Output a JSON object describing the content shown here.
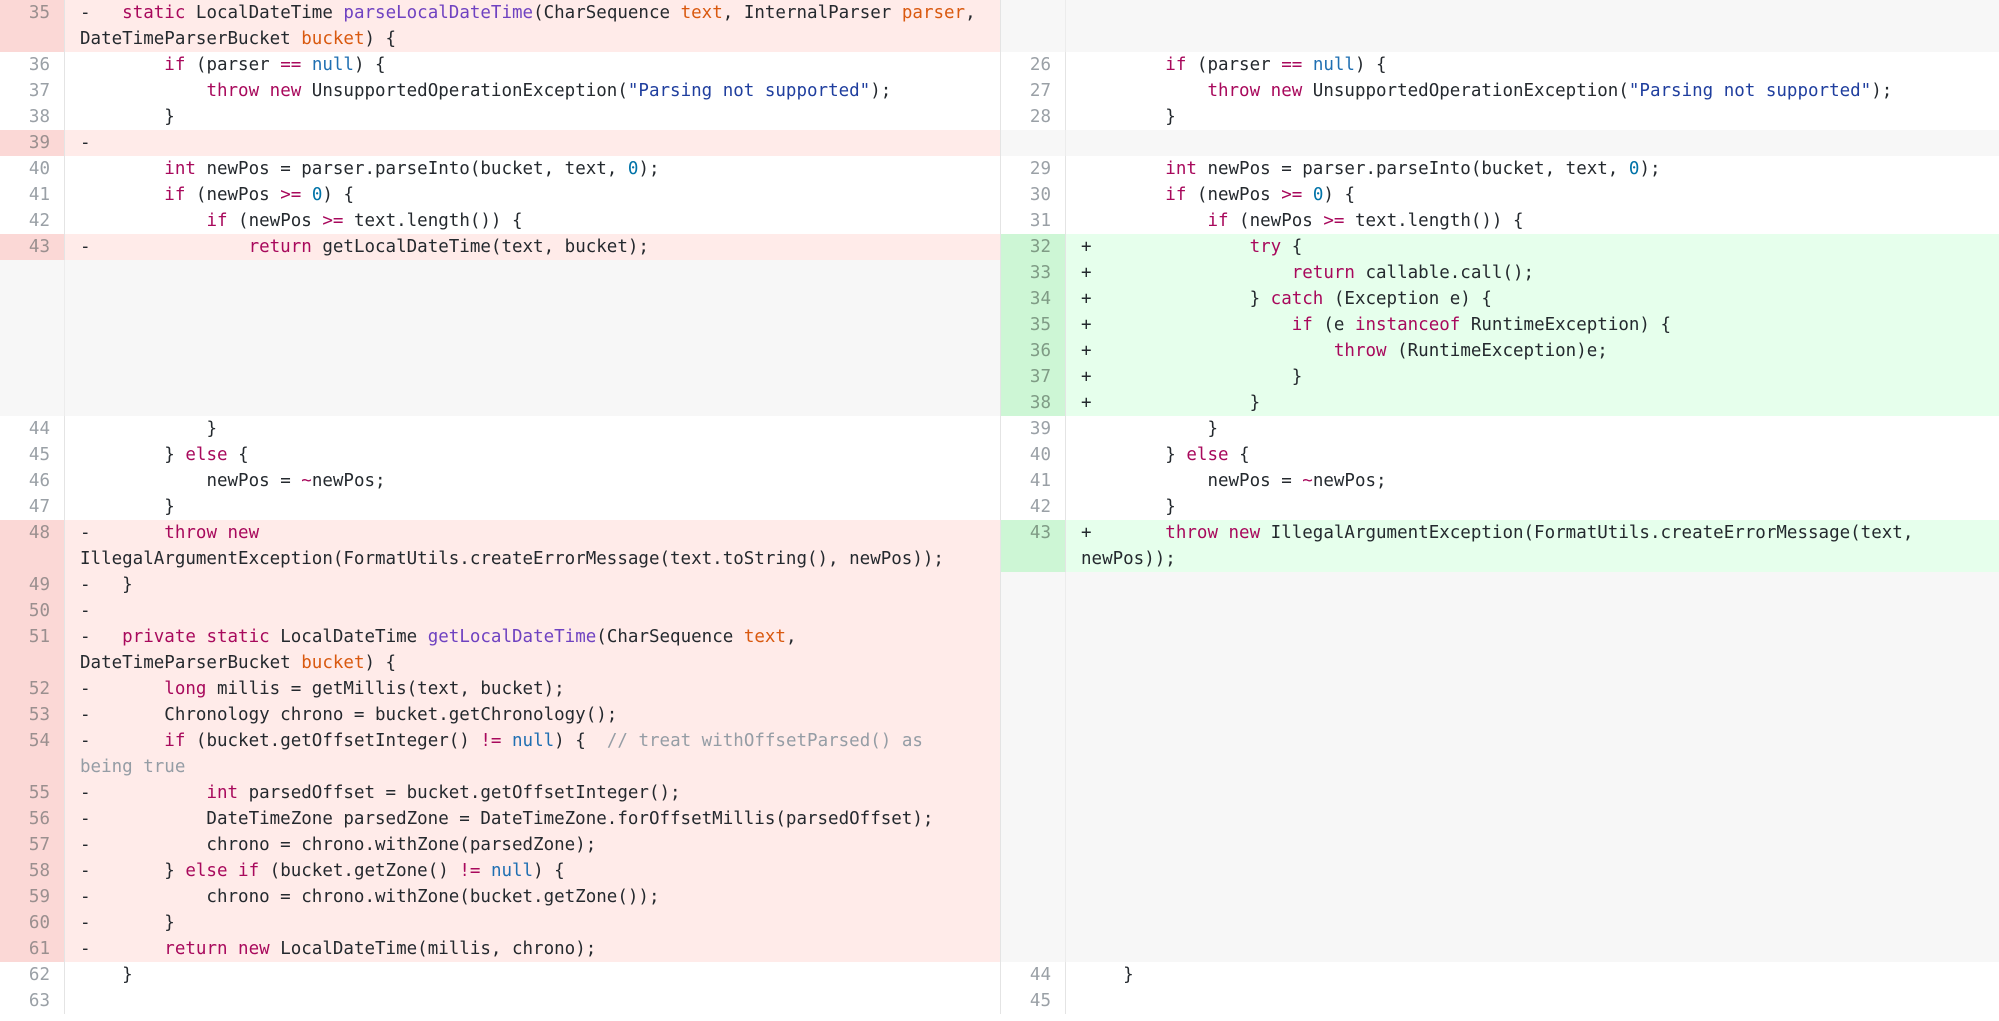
{
  "diff": {
    "left": [
      {
        "type": "del",
        "num": "35",
        "lh": 52,
        "tokens": [
          [
            "p",
            "-   "
          ],
          [
            "k",
            "static"
          ],
          [
            "p",
            " LocalDateTime "
          ],
          [
            "f",
            "parseLocalDateTime"
          ],
          [
            "p",
            "(CharSequence "
          ],
          [
            "v",
            "text"
          ],
          [
            "p",
            ", InternalParser "
          ],
          [
            "v",
            "parser"
          ],
          [
            "p",
            ",\nDateTimeParserBucket "
          ],
          [
            "v",
            "bucket"
          ],
          [
            "p",
            ") {"
          ]
        ]
      },
      {
        "type": "ctx",
        "num": "36",
        "lh": 26,
        "tokens": [
          [
            "p",
            "        "
          ],
          [
            "k",
            "if"
          ],
          [
            "p",
            " (parser "
          ],
          [
            "k",
            "=="
          ],
          [
            "p",
            " "
          ],
          [
            "n",
            "null"
          ],
          [
            "p",
            ") {"
          ]
        ]
      },
      {
        "type": "ctx",
        "num": "37",
        "lh": 26,
        "tokens": [
          [
            "p",
            "            "
          ],
          [
            "k",
            "throw new"
          ],
          [
            "p",
            " UnsupportedOperationException("
          ],
          [
            "s",
            "\"Parsing not supported\""
          ],
          [
            "p",
            ");"
          ]
        ]
      },
      {
        "type": "ctx",
        "num": "38",
        "lh": 26,
        "tokens": [
          [
            "p",
            "        }"
          ]
        ]
      },
      {
        "type": "del",
        "num": "39",
        "lh": 26,
        "tokens": [
          [
            "p",
            "-"
          ]
        ]
      },
      {
        "type": "ctx",
        "num": "40",
        "lh": 26,
        "tokens": [
          [
            "p",
            "        "
          ],
          [
            "k",
            "int"
          ],
          [
            "p",
            " newPos = parser.parseInto(bucket, text, "
          ],
          [
            "d",
            "0"
          ],
          [
            "p",
            ");"
          ]
        ]
      },
      {
        "type": "ctx",
        "num": "41",
        "lh": 26,
        "tokens": [
          [
            "p",
            "        "
          ],
          [
            "k",
            "if"
          ],
          [
            "p",
            " (newPos "
          ],
          [
            "k",
            ">="
          ],
          [
            "p",
            " "
          ],
          [
            "d",
            "0"
          ],
          [
            "p",
            ") {"
          ]
        ]
      },
      {
        "type": "ctx",
        "num": "42",
        "lh": 26,
        "tokens": [
          [
            "p",
            "            "
          ],
          [
            "k",
            "if"
          ],
          [
            "p",
            " (newPos "
          ],
          [
            "k",
            ">="
          ],
          [
            "p",
            " text.length()) {"
          ]
        ]
      },
      {
        "type": "del",
        "num": "43",
        "lh": 26,
        "tokens": [
          [
            "p",
            "-               "
          ],
          [
            "k",
            "return"
          ],
          [
            "p",
            " getLocalDateTime(text, bucket);"
          ]
        ]
      },
      {
        "type": "empty",
        "num": "",
        "lh": 156,
        "tokens": []
      },
      {
        "type": "ctx",
        "num": "44",
        "lh": 26,
        "tokens": [
          [
            "p",
            "            }"
          ]
        ]
      },
      {
        "type": "ctx",
        "num": "45",
        "lh": 26,
        "tokens": [
          [
            "p",
            "        } "
          ],
          [
            "k",
            "else"
          ],
          [
            "p",
            " {"
          ]
        ]
      },
      {
        "type": "ctx",
        "num": "46",
        "lh": 26,
        "tokens": [
          [
            "p",
            "            newPos = "
          ],
          [
            "k",
            "~"
          ],
          [
            "p",
            "newPos;"
          ]
        ]
      },
      {
        "type": "ctx",
        "num": "47",
        "lh": 26,
        "tokens": [
          [
            "p",
            "        }"
          ]
        ]
      },
      {
        "type": "del",
        "num": "48",
        "lh": 52,
        "tokens": [
          [
            "p",
            "-       "
          ],
          [
            "k",
            "throw new"
          ],
          [
            "p",
            "\nIllegalArgumentException(FormatUtils.createErrorMessage(text.toString(), newPos));"
          ]
        ]
      },
      {
        "type": "del",
        "num": "49",
        "lh": 26,
        "tokens": [
          [
            "p",
            "-   }"
          ]
        ]
      },
      {
        "type": "del",
        "num": "50",
        "lh": 26,
        "tokens": [
          [
            "p",
            "-"
          ]
        ]
      },
      {
        "type": "del",
        "num": "51",
        "lh": 52,
        "tokens": [
          [
            "p",
            "-   "
          ],
          [
            "k",
            "private static"
          ],
          [
            "p",
            " LocalDateTime "
          ],
          [
            "f",
            "getLocalDateTime"
          ],
          [
            "p",
            "(CharSequence "
          ],
          [
            "v",
            "text"
          ],
          [
            "p",
            ",\nDateTimeParserBucket "
          ],
          [
            "v",
            "bucket"
          ],
          [
            "p",
            ") {"
          ]
        ]
      },
      {
        "type": "del",
        "num": "52",
        "lh": 26,
        "tokens": [
          [
            "p",
            "-       "
          ],
          [
            "k",
            "long"
          ],
          [
            "p",
            " millis = getMillis(text, bucket);"
          ]
        ]
      },
      {
        "type": "del",
        "num": "53",
        "lh": 26,
        "tokens": [
          [
            "p",
            "-       Chronology chrono = bucket.getChronology();"
          ]
        ]
      },
      {
        "type": "del",
        "num": "54",
        "lh": 52,
        "tokens": [
          [
            "p",
            "-       "
          ],
          [
            "k",
            "if"
          ],
          [
            "p",
            " (bucket.getOffsetInteger() "
          ],
          [
            "k",
            "!="
          ],
          [
            "p",
            " "
          ],
          [
            "n",
            "null"
          ],
          [
            "p",
            ") {  "
          ],
          [
            "c",
            "// treat withOffsetParsed() as\nbeing true"
          ]
        ]
      },
      {
        "type": "del",
        "num": "55",
        "lh": 26,
        "tokens": [
          [
            "p",
            "-           "
          ],
          [
            "k",
            "int"
          ],
          [
            "p",
            " parsedOffset = bucket.getOffsetInteger();"
          ]
        ]
      },
      {
        "type": "del",
        "num": "56",
        "lh": 26,
        "tokens": [
          [
            "p",
            "-           DateTimeZone parsedZone = DateTimeZone.forOffsetMillis(parsedOffset);"
          ]
        ]
      },
      {
        "type": "del",
        "num": "57",
        "lh": 26,
        "tokens": [
          [
            "p",
            "-           chrono = chrono.withZone(parsedZone);"
          ]
        ]
      },
      {
        "type": "del",
        "num": "58",
        "lh": 26,
        "tokens": [
          [
            "p",
            "-       } "
          ],
          [
            "k",
            "else if"
          ],
          [
            "p",
            " (bucket.getZone() "
          ],
          [
            "k",
            "!="
          ],
          [
            "p",
            " "
          ],
          [
            "n",
            "null"
          ],
          [
            "p",
            ") {"
          ]
        ]
      },
      {
        "type": "del",
        "num": "59",
        "lh": 26,
        "tokens": [
          [
            "p",
            "-           chrono = chrono.withZone(bucket.getZone());"
          ]
        ]
      },
      {
        "type": "del",
        "num": "60",
        "lh": 26,
        "tokens": [
          [
            "p",
            "-       }"
          ]
        ]
      },
      {
        "type": "del",
        "num": "61",
        "lh": 26,
        "tokens": [
          [
            "p",
            "-       "
          ],
          [
            "k",
            "return new"
          ],
          [
            "p",
            " LocalDateTime(millis, chrono);"
          ]
        ]
      },
      {
        "type": "ctx",
        "num": "62",
        "lh": 26,
        "tokens": [
          [
            "p",
            "    }"
          ]
        ]
      },
      {
        "type": "ctx",
        "num": "63",
        "lh": 26,
        "tokens": [
          [
            "p",
            ""
          ]
        ]
      }
    ],
    "right": [
      {
        "type": "empty",
        "num": "",
        "lh": 52,
        "tokens": []
      },
      {
        "type": "ctx",
        "num": "26",
        "lh": 26,
        "tokens": [
          [
            "p",
            "        "
          ],
          [
            "k",
            "if"
          ],
          [
            "p",
            " (parser "
          ],
          [
            "k",
            "=="
          ],
          [
            "p",
            " "
          ],
          [
            "n",
            "null"
          ],
          [
            "p",
            ") {"
          ]
        ]
      },
      {
        "type": "ctx",
        "num": "27",
        "lh": 26,
        "tokens": [
          [
            "p",
            "            "
          ],
          [
            "k",
            "throw new"
          ],
          [
            "p",
            " UnsupportedOperationException("
          ],
          [
            "s",
            "\"Parsing not supported\""
          ],
          [
            "p",
            ");"
          ]
        ]
      },
      {
        "type": "ctx",
        "num": "28",
        "lh": 26,
        "tokens": [
          [
            "p",
            "        }"
          ]
        ]
      },
      {
        "type": "empty",
        "num": "",
        "lh": 26,
        "tokens": []
      },
      {
        "type": "ctx",
        "num": "29",
        "lh": 26,
        "tokens": [
          [
            "p",
            "        "
          ],
          [
            "k",
            "int"
          ],
          [
            "p",
            " newPos = parser.parseInto(bucket, text, "
          ],
          [
            "d",
            "0"
          ],
          [
            "p",
            ");"
          ]
        ]
      },
      {
        "type": "ctx",
        "num": "30",
        "lh": 26,
        "tokens": [
          [
            "p",
            "        "
          ],
          [
            "k",
            "if"
          ],
          [
            "p",
            " (newPos "
          ],
          [
            "k",
            ">="
          ],
          [
            "p",
            " "
          ],
          [
            "d",
            "0"
          ],
          [
            "p",
            ") {"
          ]
        ]
      },
      {
        "type": "ctx",
        "num": "31",
        "lh": 26,
        "tokens": [
          [
            "p",
            "            "
          ],
          [
            "k",
            "if"
          ],
          [
            "p",
            " (newPos "
          ],
          [
            "k",
            ">="
          ],
          [
            "p",
            " text.length()) {"
          ]
        ]
      },
      {
        "type": "add",
        "num": "32",
        "lh": 26,
        "tokens": [
          [
            "p",
            "+               "
          ],
          [
            "k",
            "try"
          ],
          [
            "p",
            " {"
          ]
        ]
      },
      {
        "type": "add",
        "num": "33",
        "lh": 26,
        "tokens": [
          [
            "p",
            "+                   "
          ],
          [
            "k",
            "return"
          ],
          [
            "p",
            " callable.call();"
          ]
        ]
      },
      {
        "type": "add",
        "num": "34",
        "lh": 26,
        "tokens": [
          [
            "p",
            "+               } "
          ],
          [
            "k",
            "catch"
          ],
          [
            "p",
            " (Exception e) {"
          ]
        ]
      },
      {
        "type": "add",
        "num": "35",
        "lh": 26,
        "tokens": [
          [
            "p",
            "+                   "
          ],
          [
            "k",
            "if"
          ],
          [
            "p",
            " (e "
          ],
          [
            "k",
            "instanceof"
          ],
          [
            "p",
            " RuntimeException) {"
          ]
        ]
      },
      {
        "type": "add",
        "num": "36",
        "lh": 26,
        "tokens": [
          [
            "p",
            "+                       "
          ],
          [
            "k",
            "throw"
          ],
          [
            "p",
            " (RuntimeException)e;"
          ]
        ]
      },
      {
        "type": "add",
        "num": "37",
        "lh": 26,
        "tokens": [
          [
            "p",
            "+                   }"
          ]
        ]
      },
      {
        "type": "add",
        "num": "38",
        "lh": 26,
        "tokens": [
          [
            "p",
            "+               }"
          ]
        ]
      },
      {
        "type": "ctx",
        "num": "39",
        "lh": 26,
        "tokens": [
          [
            "p",
            "            }"
          ]
        ]
      },
      {
        "type": "ctx",
        "num": "40",
        "lh": 26,
        "tokens": [
          [
            "p",
            "        } "
          ],
          [
            "k",
            "else"
          ],
          [
            "p",
            " {"
          ]
        ]
      },
      {
        "type": "ctx",
        "num": "41",
        "lh": 26,
        "tokens": [
          [
            "p",
            "            newPos = "
          ],
          [
            "k",
            "~"
          ],
          [
            "p",
            "newPos;"
          ]
        ]
      },
      {
        "type": "ctx",
        "num": "42",
        "lh": 26,
        "tokens": [
          [
            "p",
            "        }"
          ]
        ]
      },
      {
        "type": "add",
        "num": "43",
        "lh": 52,
        "tokens": [
          [
            "p",
            "+       "
          ],
          [
            "k",
            "throw new"
          ],
          [
            "p",
            " IllegalArgumentException(FormatUtils.createErrorMessage(text,\nnewPos));"
          ]
        ]
      },
      {
        "type": "empty",
        "num": "",
        "lh": 390,
        "tokens": []
      },
      {
        "type": "ctx",
        "num": "44",
        "lh": 26,
        "tokens": [
          [
            "p",
            "    }"
          ]
        ]
      },
      {
        "type": "ctx",
        "num": "45",
        "lh": 26,
        "tokens": [
          [
            "p",
            ""
          ]
        ]
      }
    ]
  }
}
